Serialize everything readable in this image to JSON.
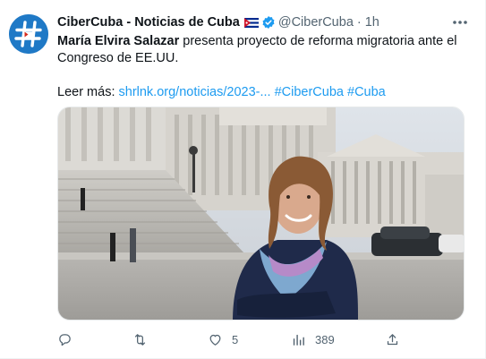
{
  "tweet": {
    "author_name": "CiberCuba - Noticias de Cuba",
    "handle": "@CiberCuba",
    "separator": "·",
    "time": "1h",
    "text_bold": "María Elvira Salazar",
    "text_rest": " presenta proyecto de reforma migratoria ante el Congreso de EE.UU.",
    "read_more_label": "Leer más: ",
    "link_text": "shrlnk.org/noticias/2023-...",
    "hashtag_1": "#CiberCuba",
    "hashtag_2": "#Cuba"
  },
  "actions": {
    "replies": "",
    "retweets": "",
    "likes": "5",
    "views": "389"
  },
  "icons": [
    "hash-logo-icon",
    "cuba-flag-icon",
    "verified-badge-icon",
    "more-options-icon",
    "reply-icon",
    "retweet-icon",
    "like-icon",
    "views-icon",
    "share-icon"
  ],
  "colors": {
    "accent": "#1d9bf0",
    "text": "#0f1419",
    "muted": "#536471",
    "avatar_bg": "#1f79c6"
  }
}
